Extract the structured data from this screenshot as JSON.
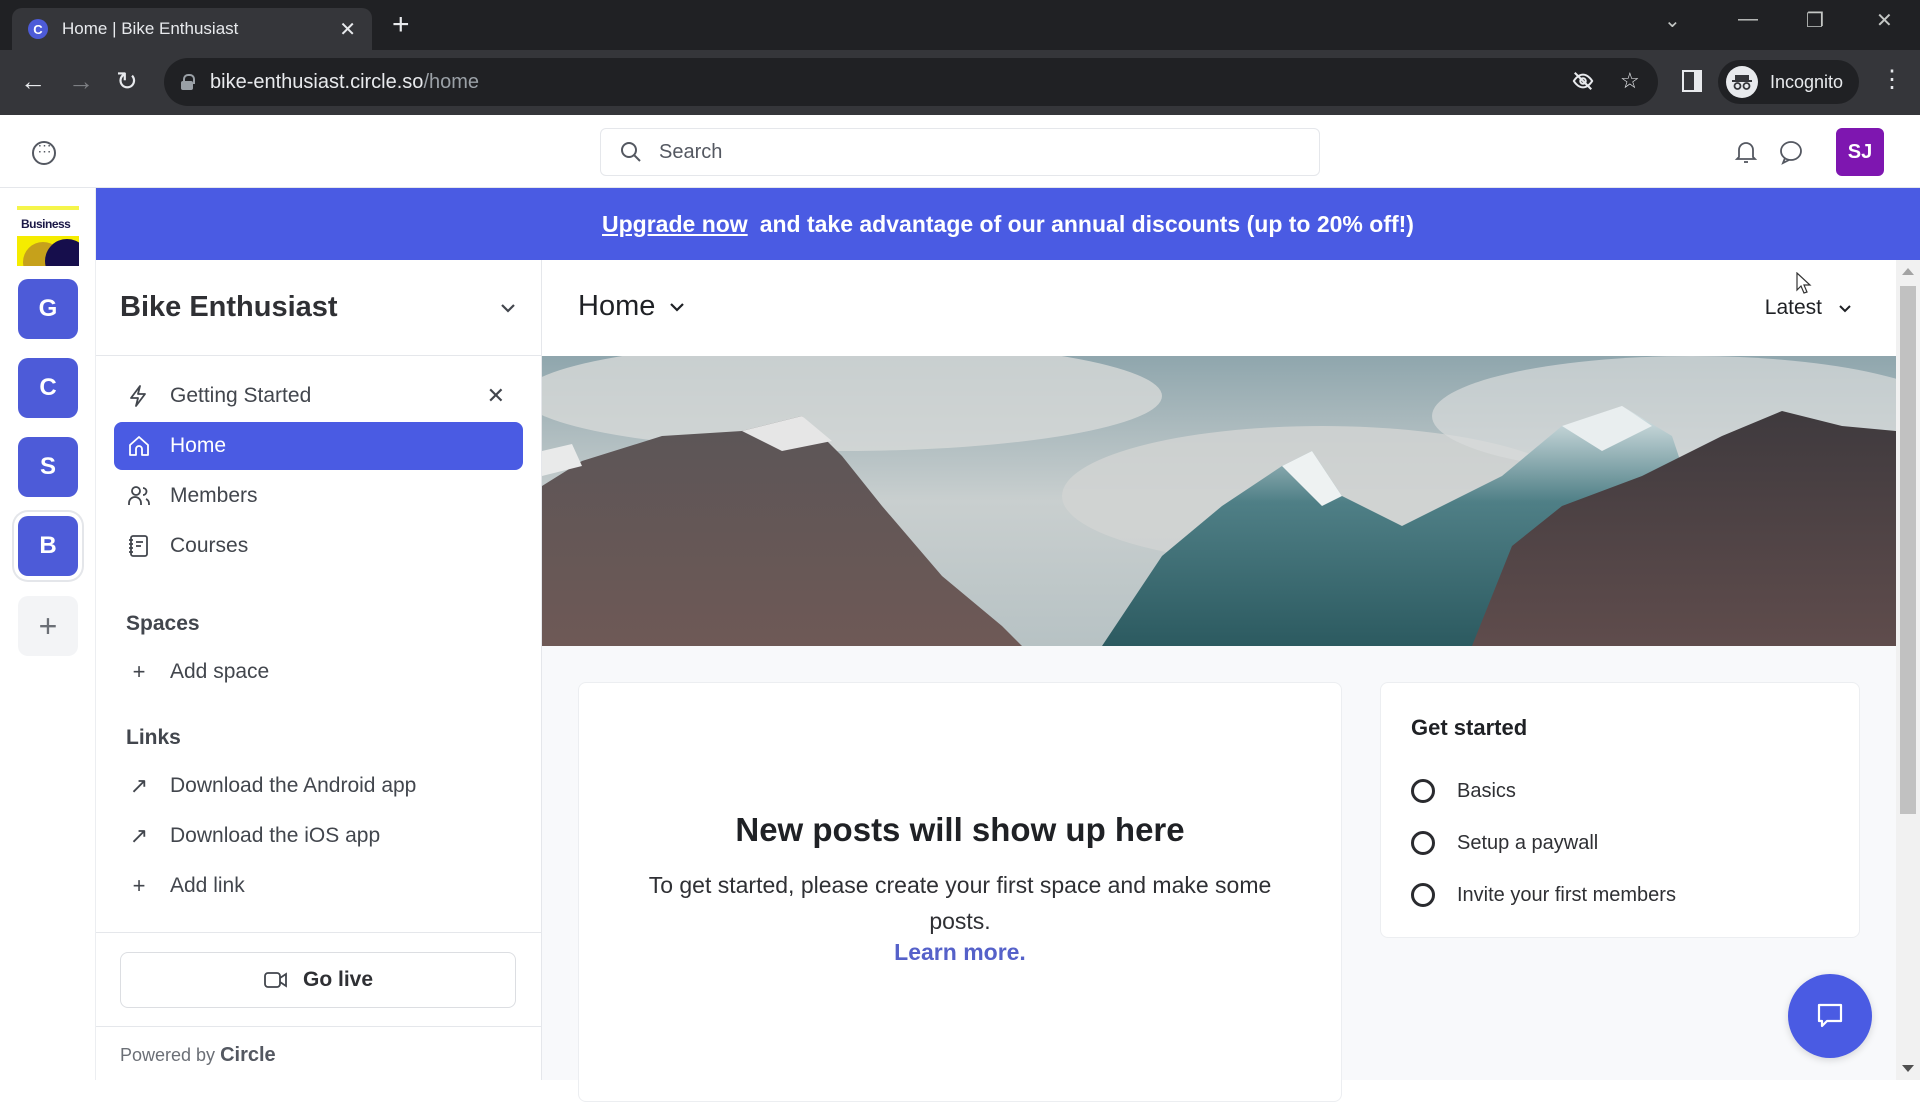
{
  "browser": {
    "tab_title": "Home | Bike Enthusiast",
    "tab_favicon_letter": "C",
    "url_host": "bike-enthusiast.circle.so",
    "url_path": "/home",
    "profile_label": "Incognito"
  },
  "header": {
    "search_placeholder": "Search",
    "user_initials": "SJ",
    "user_avatar_color": "#7e16b0"
  },
  "rail": {
    "logo_text": "Business",
    "communities": [
      {
        "letter": "G"
      },
      {
        "letter": "C"
      },
      {
        "letter": "S"
      },
      {
        "letter": "B",
        "active": true
      }
    ],
    "add_label": "+"
  },
  "banner": {
    "link_label": "Upgrade now",
    "text": "and take advantage of our annual discounts (up to 20% off!)",
    "color": "#4a5be3"
  },
  "sidebar": {
    "community_name": "Bike Enthusiast",
    "nav": [
      {
        "label": "Getting Started",
        "icon": "lightning-icon",
        "dismissible": true
      },
      {
        "label": "Home",
        "icon": "home-icon",
        "active": true
      },
      {
        "label": "Members",
        "icon": "members-icon"
      },
      {
        "label": "Courses",
        "icon": "courses-icon"
      }
    ],
    "spaces_heading": "Spaces",
    "add_space_label": "Add space",
    "links_heading": "Links",
    "links": [
      {
        "label": "Download the Android app"
      },
      {
        "label": "Download the iOS app"
      }
    ],
    "add_link_label": "Add link",
    "go_live_label": "Go live",
    "powered_by_prefix": "Powered by",
    "powered_by_brand": "Circle"
  },
  "main": {
    "page_title": "Home",
    "sort_label": "Latest",
    "empty_feed": {
      "title": "New posts will show up here",
      "body": "To get started, please create your first space and make some posts.",
      "link": "Learn more."
    },
    "get_started": {
      "title": "Get started",
      "items": [
        {
          "label": "Basics",
          "done": false
        },
        {
          "label": "Setup a paywall",
          "done": false
        },
        {
          "label": "Invite your first members",
          "done": false
        }
      ]
    }
  },
  "colors": {
    "accent": "#4a5be3",
    "link": "#5561c9"
  }
}
